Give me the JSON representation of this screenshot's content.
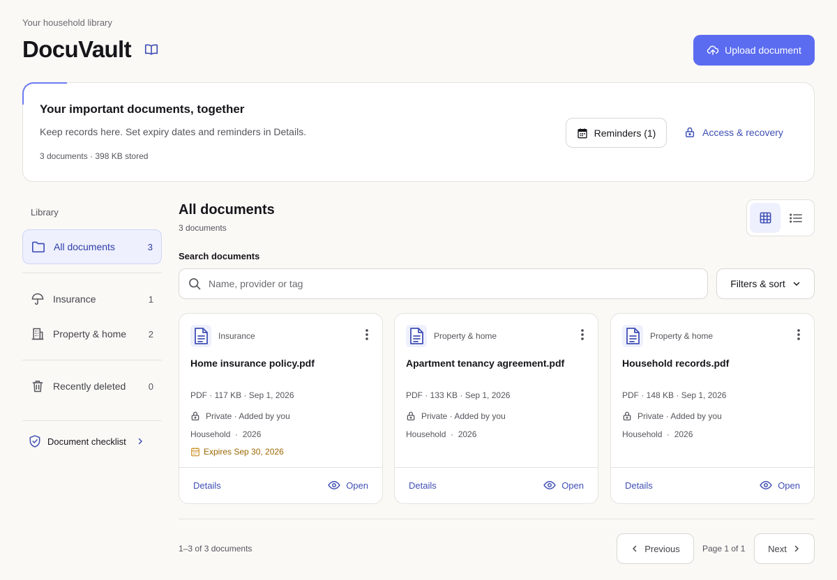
{
  "header": {
    "eyebrow": "Your household library",
    "app_title": "DocuVault",
    "upload_label": "Upload document",
    "brand_color": "#5b6cf0"
  },
  "hero": {
    "title": "Your important documents, together",
    "subtitle": "Keep records here. Set expiry dates and reminders in Details.",
    "meta": "3 documents · 398 KB stored",
    "reminders_label": "Reminders (1)",
    "access_label": "Access & recovery"
  },
  "sidebar": {
    "heading": "Library",
    "items": [
      {
        "label": "All documents",
        "count": "3",
        "icon": "folder-icon"
      },
      {
        "label": "Insurance",
        "count": "1",
        "icon": "umbrella-icon"
      },
      {
        "label": "Property & home",
        "count": "2",
        "icon": "building-icon"
      },
      {
        "label": "Recently deleted",
        "count": "0",
        "icon": "trash-icon"
      }
    ],
    "checklist_label": "Document checklist"
  },
  "main": {
    "title": "All documents",
    "count": "3 documents",
    "search_label": "Search documents",
    "search_placeholder": "Name, provider or tag",
    "filters_label": "Filters & sort",
    "view_mode": "grid"
  },
  "documents": [
    {
      "category": "Insurance",
      "name": "Home insurance policy.pdf",
      "meta": "PDF · 117 KB · Sep 1, 2026",
      "privacy": "Private · Added by you",
      "tags": "Household  ·  2026",
      "expires": "Expires Sep 30, 2026",
      "details": "Details",
      "open": "Open"
    },
    {
      "category": "Property & home",
      "name": "Apartment tenancy agreement.pdf",
      "meta": "PDF · 133 KB · Sep 1, 2026",
      "privacy": "Private · Added by you",
      "tags": "Household  ·  2026",
      "details": "Details",
      "open": "Open"
    },
    {
      "category": "Property & home",
      "name": "Household records.pdf",
      "meta": "PDF · 148 KB · Sep 1, 2026",
      "privacy": "Private · Added by you",
      "tags": "Household  ·  2026",
      "details": "Details",
      "open": "Open"
    }
  ],
  "pagination": {
    "range": "1–3 of 3 documents",
    "previous": "Previous",
    "page": "Page 1 of 1",
    "next": "Next"
  }
}
